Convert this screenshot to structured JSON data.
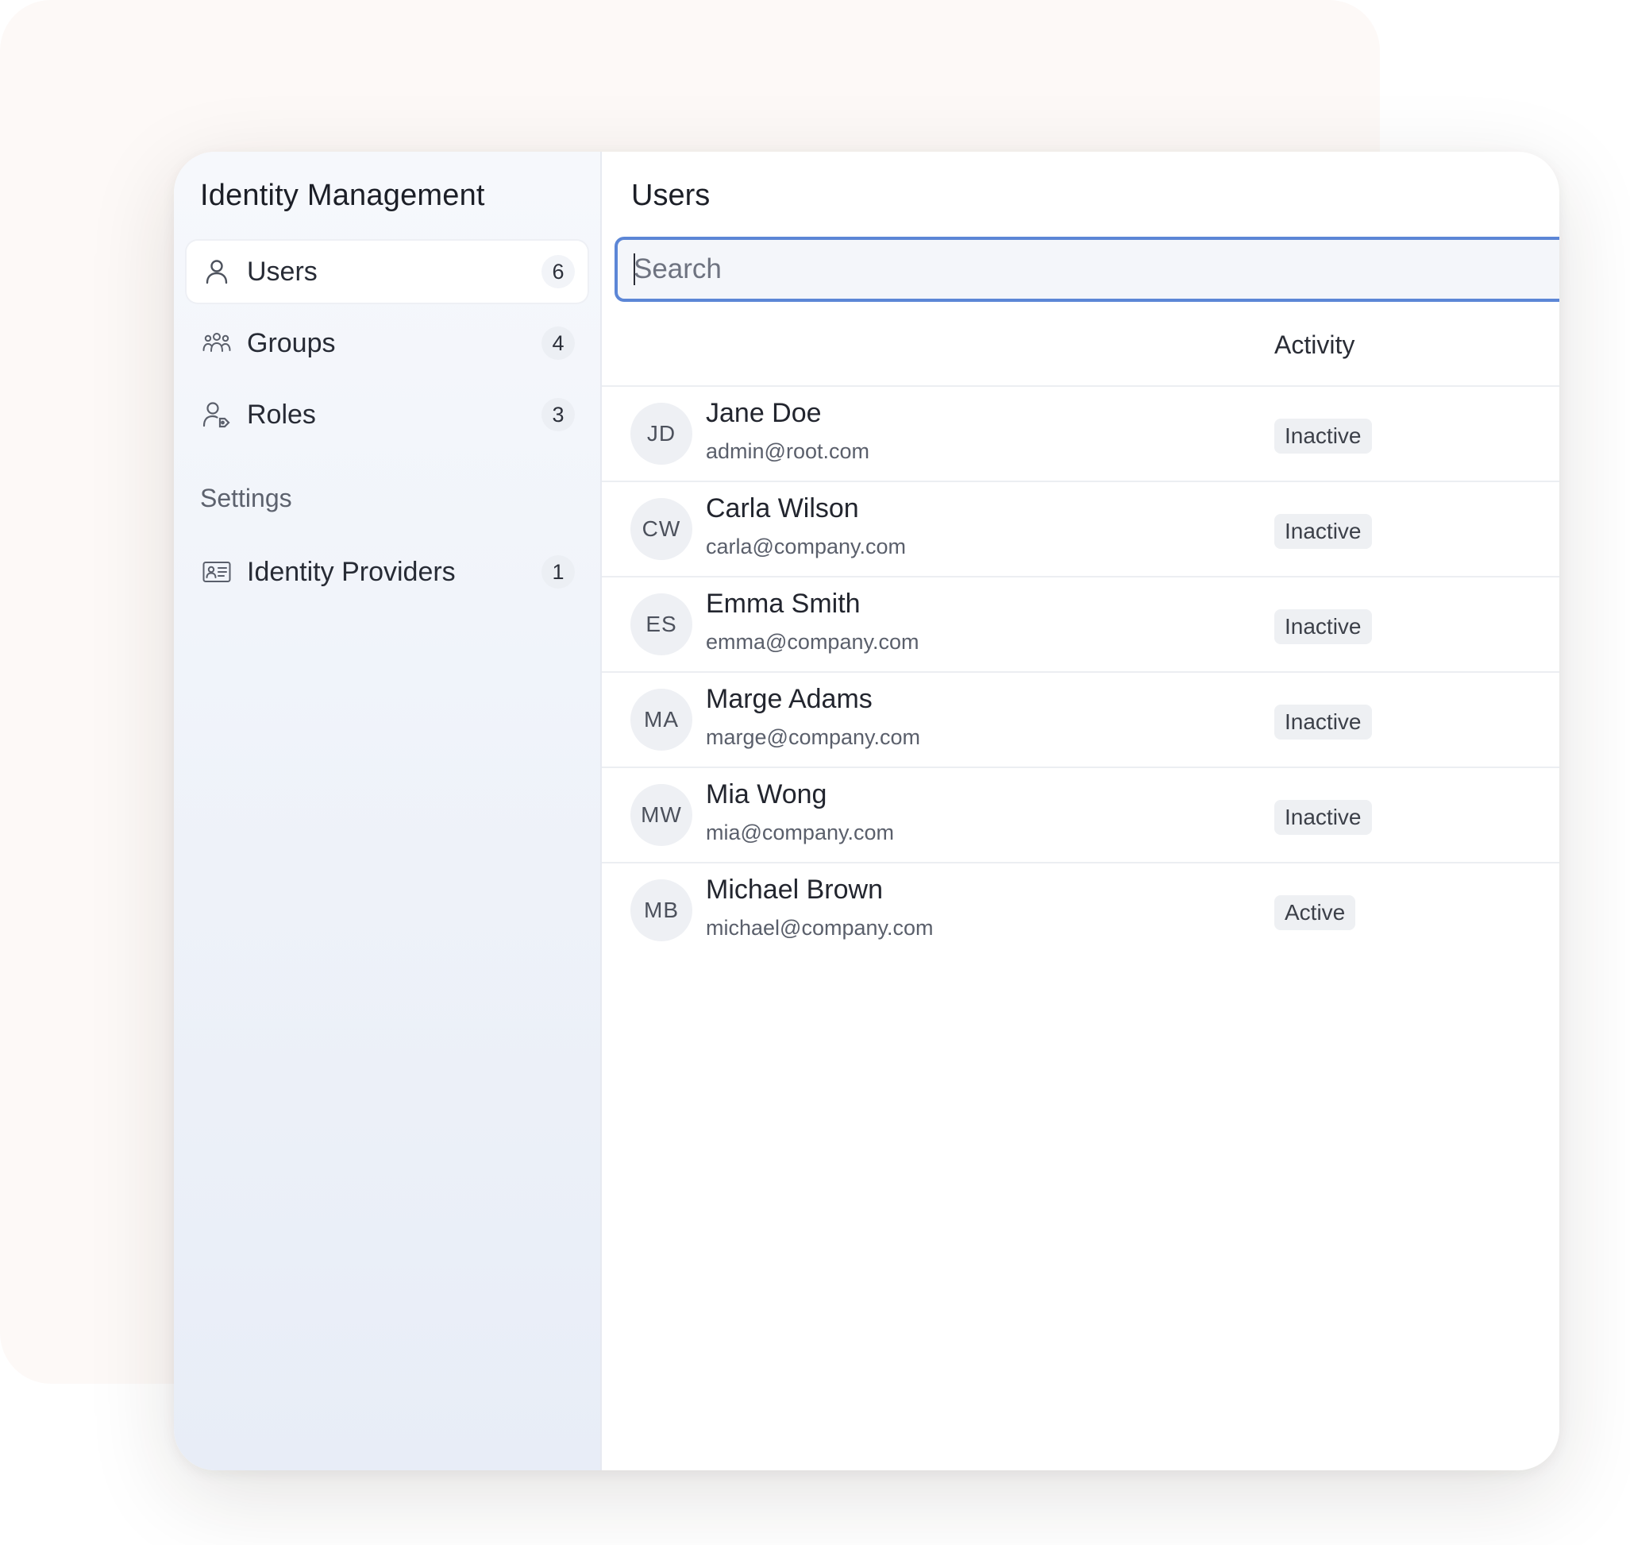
{
  "sidebar": {
    "title": "Identity Management",
    "items": [
      {
        "label": "Users",
        "count": "6",
        "icon": "user-icon",
        "active": true
      },
      {
        "label": "Groups",
        "count": "4",
        "icon": "group-icon",
        "active": false
      },
      {
        "label": "Roles",
        "count": "3",
        "icon": "role-icon",
        "active": false
      }
    ],
    "settings_label": "Settings",
    "settings_items": [
      {
        "label": "Identity Providers",
        "count": "1",
        "icon": "id-card-icon"
      }
    ]
  },
  "main": {
    "title": "Users",
    "search": {
      "placeholder": "Search",
      "value": ""
    },
    "table": {
      "activity_header": "Activity",
      "rows": [
        {
          "initials": "JD",
          "name": "Jane Doe",
          "email": "admin@root.com",
          "status": "Inactive"
        },
        {
          "initials": "CW",
          "name": "Carla Wilson",
          "email": "carla@company.com",
          "status": "Inactive"
        },
        {
          "initials": "ES",
          "name": "Emma Smith",
          "email": "emma@company.com",
          "status": "Inactive"
        },
        {
          "initials": "MA",
          "name": "Marge Adams",
          "email": "marge@company.com",
          "status": "Inactive"
        },
        {
          "initials": "MW",
          "name": "Mia Wong",
          "email": "mia@company.com",
          "status": "Inactive"
        },
        {
          "initials": "MB",
          "name": "Michael Brown",
          "email": "michael@company.com",
          "status": "Active"
        }
      ]
    }
  },
  "colors": {
    "accent": "#5c86d6",
    "sidebar_bg": "#eef2f9",
    "backdrop": "#fdf9f7",
    "badge_bg": "#eef0f3"
  }
}
